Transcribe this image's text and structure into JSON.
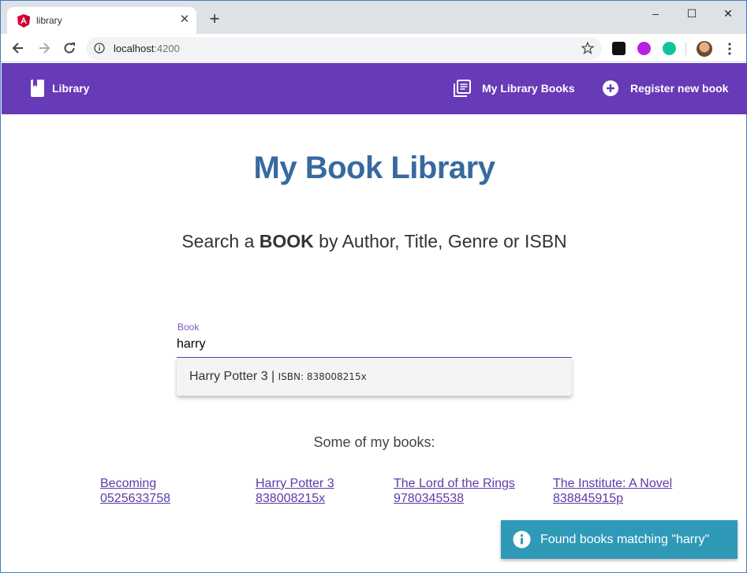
{
  "browser": {
    "tab_title": "library",
    "new_tab_label": "+",
    "url_host": "localhost",
    "url_port": ":4200",
    "window_controls": [
      "–",
      "☐",
      "✕"
    ]
  },
  "appbar": {
    "color": "#673ab7",
    "brand_label": "Library",
    "nav": [
      {
        "label": "My Library Books",
        "icon": "library-books-icon"
      },
      {
        "label": "Register new book",
        "icon": "add-circle-icon"
      }
    ]
  },
  "main": {
    "title": "My Book Library",
    "subtitle_pre": "Search a ",
    "subtitle_bold": "BOOK",
    "subtitle_post": " by Author, Title, Genre or ISBN",
    "search": {
      "label": "Book",
      "value": "harry"
    },
    "autocomplete": [
      {
        "title": "Harry Potter 3",
        "separator": " | ",
        "isbn_label": "ISBN: 838008215x"
      }
    ],
    "some_books_heading": "Some of my books:",
    "books": [
      {
        "title": "Becoming",
        "isbn": "0525633758"
      },
      {
        "title": "Harry Potter 3",
        "isbn": "838008215x"
      },
      {
        "title": "The Lord of the Rings",
        "isbn": "9780345538"
      },
      {
        "title": "The Institute: A Novel",
        "isbn": "838845915p"
      }
    ]
  },
  "toast": {
    "message": "Found books matching \"harry\"",
    "color": "#2e9ab8",
    "icon": "info-icon"
  }
}
